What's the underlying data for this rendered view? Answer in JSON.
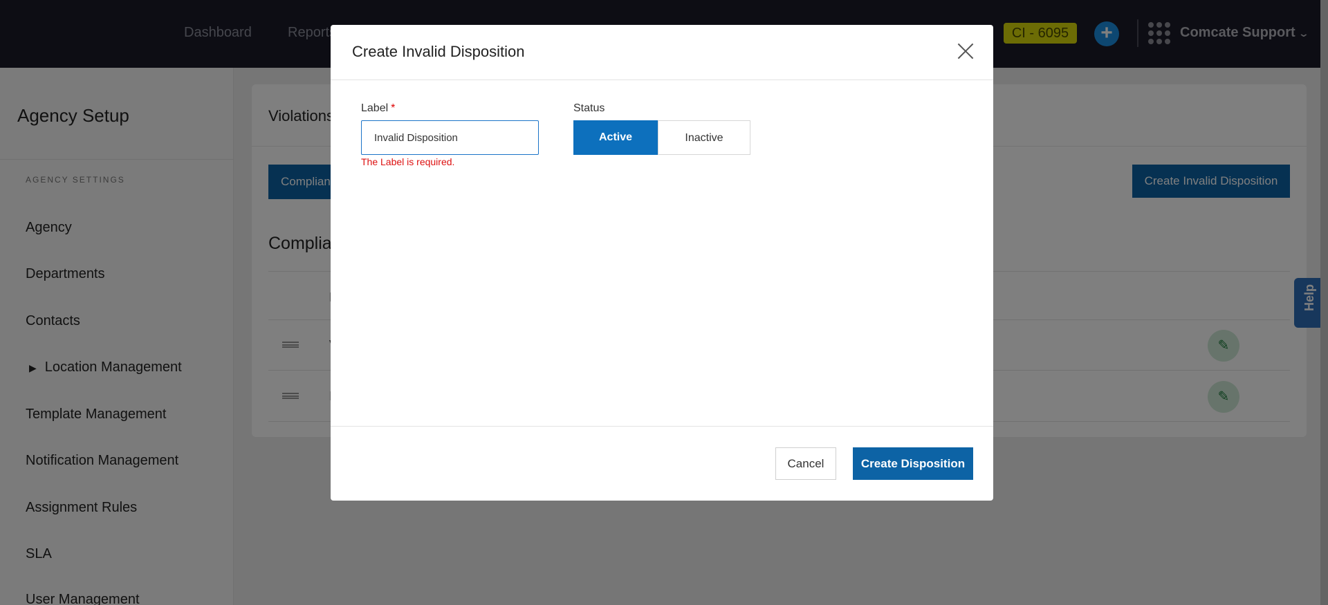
{
  "topbar": {
    "nav": [
      "Dashboard",
      "Reports"
    ],
    "ci_badge": "CI - 6095",
    "plus_label": "+",
    "user": "Comcate Support"
  },
  "sidebar": {
    "title": "Agency Setup",
    "section": "AGENCY SETTINGS",
    "items": [
      "Agency",
      "Departments",
      "Contacts",
      "Location Management",
      "Template Management",
      "Notification Management",
      "Assignment Rules",
      "SLA",
      "User Management"
    ]
  },
  "main": {
    "card_title": "Violations",
    "tab_label": "Compliance",
    "create_button": "Create Invalid Disposition",
    "section_title": "Compliance",
    "row_letters": [
      "V",
      "I"
    ],
    "header_letter": "L"
  },
  "help": "Help",
  "modal": {
    "title": "Create Invalid Disposition",
    "label_field": "Label",
    "required_mark": "*",
    "label_value": "Invalid Disposition",
    "error": "The Label is required.",
    "status_field": "Status",
    "status_options": [
      "Active",
      "Inactive"
    ],
    "status_selected": "Active",
    "cancel": "Cancel",
    "submit": "Create Disposition"
  },
  "colors": {
    "primary": "#0d63a5",
    "accent_blue": "#1a8fe3",
    "badge": "#d9d90a",
    "error": "#d11111",
    "topbar": "#1b1b28"
  }
}
